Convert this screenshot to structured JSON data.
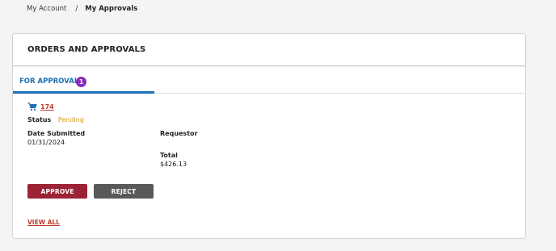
{
  "breadcrumb": {
    "items": [
      "My Account",
      "My Approvals"
    ],
    "separator": "/"
  },
  "card": {
    "title": "ORDERS AND APPROVALS"
  },
  "tabs": [
    {
      "label": "FOR APPROVALS",
      "badge": "1",
      "active": true
    }
  ],
  "order": {
    "number": "174",
    "icon": "cart-icon",
    "status_label": "Status",
    "status_value": "Pending",
    "date_submitted_label": "Date Submitted",
    "date_submitted_value": "01/31/2024",
    "requestor_label": "Requestor",
    "requestor_value": "",
    "total_label": "Total",
    "total_value": "$426.13"
  },
  "actions": {
    "approve_label": "APPROVE",
    "reject_label": "REJECT",
    "view_all_label": "VIEW ALL"
  },
  "colors": {
    "accent_blue": "#1f6fb8",
    "badge_purple": "#8a2bb8",
    "approve_red": "#9c2236",
    "reject_gray": "#595959",
    "link_red": "#c0392b",
    "pending_amber": "#d39b1e"
  }
}
